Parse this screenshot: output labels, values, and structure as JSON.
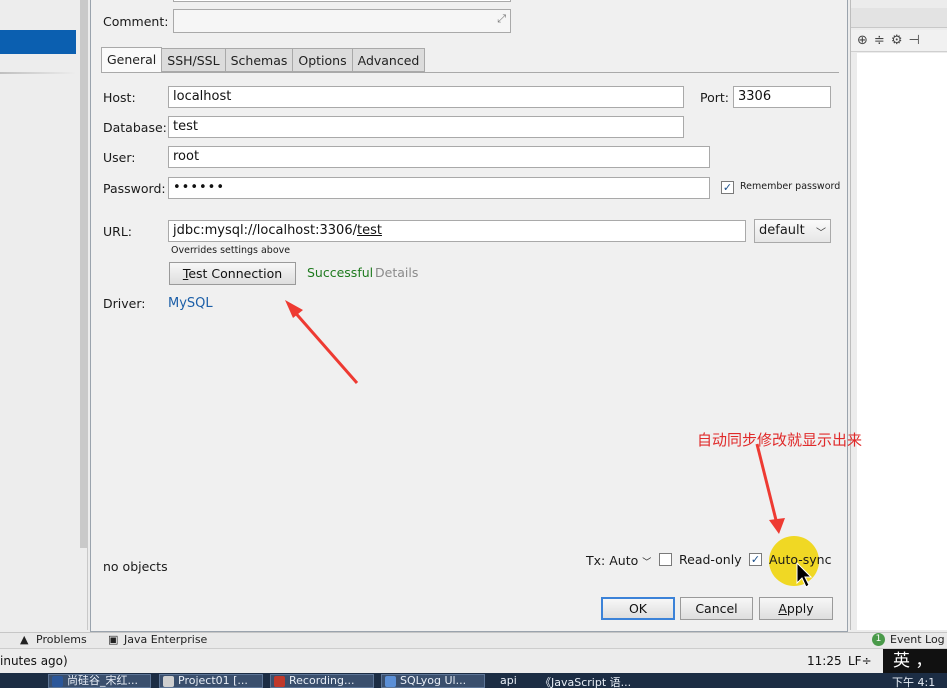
{
  "dialog": {
    "comment_label": "Comment:",
    "tabs": [
      "General",
      "SSH/SSL",
      "Schemas",
      "Options",
      "Advanced"
    ],
    "host_label": "Host:",
    "host_value": "localhost",
    "port_label": "Port:",
    "port_value": "3306",
    "database_label": "Database:",
    "database_value": "test",
    "user_label": "User:",
    "user_value": "root",
    "password_label": "Password:",
    "password_value": "••••••",
    "remember_password_label": "Remember password",
    "remember_password_checked": true,
    "url_label": "URL:",
    "url_prefix": "jdbc:mysql://localhost:3306/",
    "url_db": "test",
    "url_mode": "default",
    "overrides_note": "Overrides settings above",
    "test_connection_pre": "T",
    "test_connection_rest": "est Connection",
    "test_status": "Successful",
    "details_label": "Details",
    "driver_label": "Driver:",
    "driver_value": "MySQL",
    "objects_status": "no objects",
    "tx_label": "Tx: Auto",
    "readonly_label": "Read-only",
    "readonly_checked": false,
    "autosync_label": "Auto-sync",
    "autosync_checked": true,
    "ok_label": "OK",
    "cancel_label": "Cancel",
    "apply_pre": "A",
    "apply_rest": "pply"
  },
  "annotation": {
    "text": "自动同步修改就显示出来",
    "color": "#e02a2a"
  },
  "ide": {
    "problems_tab": "Problems",
    "java_enterprise_tab": "Java Enterprise",
    "event_log_badge": "1",
    "event_log_label": "Event Log",
    "status_left": "inutes ago)",
    "status_time": "11:25",
    "status_lf": "LF÷",
    "ime_label": "英",
    "ime_punct": "，"
  },
  "taskbar": {
    "items": [
      "尚硅谷_宋红...",
      "Project01 [...",
      "Recording...",
      "SQLyog Ul...",
      "api",
      "《JavaScript 语..."
    ],
    "clock": "下午 4:1"
  },
  "colors": {
    "accent": "#0b5fb0",
    "success": "#1e7a1e",
    "link": "#1c5fa8",
    "annotation": "#e02a2a"
  }
}
